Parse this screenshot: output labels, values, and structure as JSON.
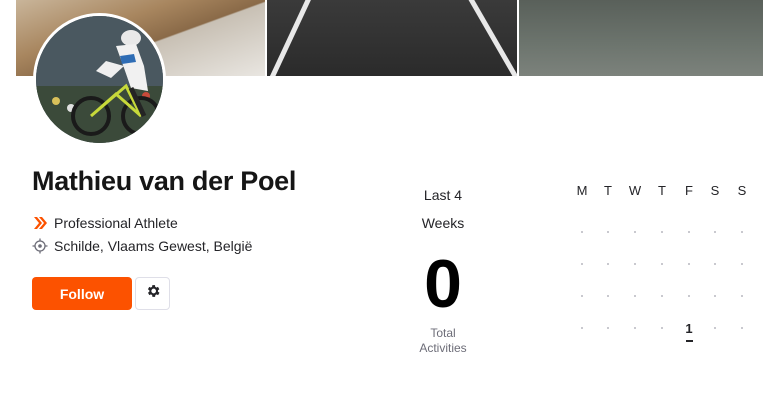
{
  "profile": {
    "name": "Mathieu van der Poel",
    "role": "Professional Athlete",
    "location": "Schilde, Vlaams Gewest, België"
  },
  "actions": {
    "follow_label": "Follow"
  },
  "stats": {
    "period_line1": "Last 4",
    "period_line2": "Weeks",
    "count": "0",
    "count_label_line1": "Total",
    "count_label_line2": "Activities"
  },
  "calendar": {
    "days": [
      "M",
      "T",
      "W",
      "T",
      "F",
      "S",
      "S"
    ],
    "highlight_day": "1"
  },
  "colors": {
    "accent": "#fc5200",
    "text": "#242428"
  },
  "icons": {
    "role": "chevron-double-icon",
    "location": "location-target-icon",
    "settings": "gear-icon"
  }
}
